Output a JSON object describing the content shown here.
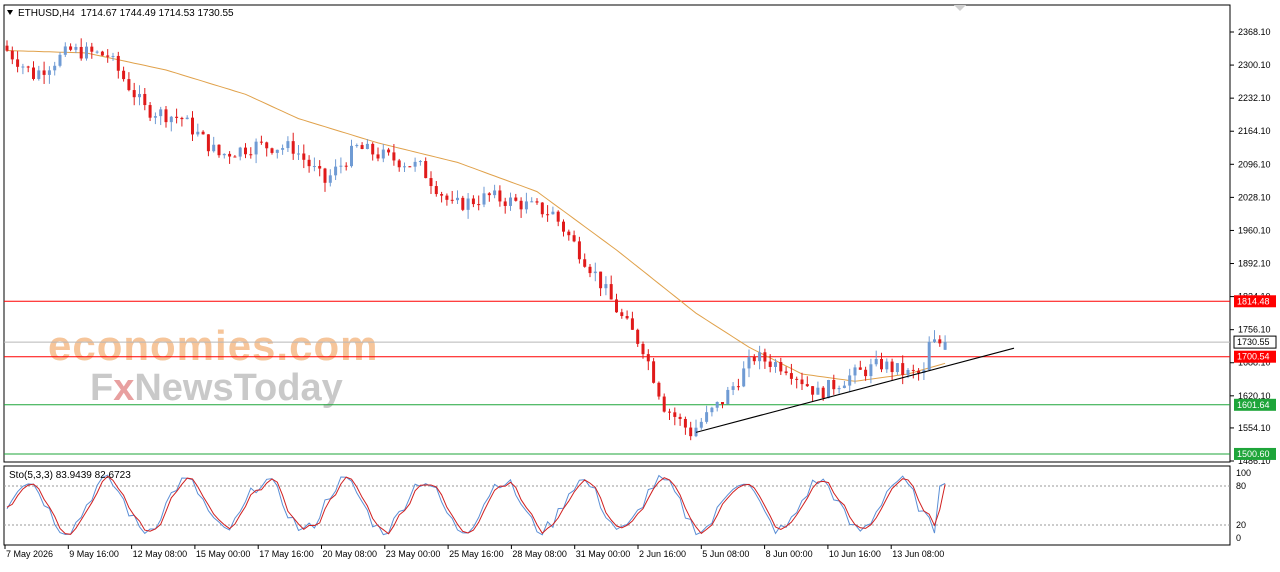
{
  "header": {
    "symbol": "ETHUSD,H4",
    "ohlc": "1714.67 1744.49 1714.53 1730.55",
    "stoch_label": "Sto(5,3,3) 83.9439 82.6723"
  },
  "watermark": {
    "line1": "economies.com",
    "line2_prefix": "F",
    "line2_x": "x",
    "line2_rest": "NewsToday"
  },
  "chart_data": {
    "type": "candlestick",
    "instrument": "ETHUSD",
    "timeframe": "H4",
    "y_ticks": [
      "2368.10",
      "2300.10",
      "2232.10",
      "2164.10",
      "2096.10",
      "2028.10",
      "1960.10",
      "1892.10",
      "1824.10",
      "1756.10",
      "1688.10",
      "1620.10",
      "1554.10",
      "1486.10"
    ],
    "x_ticks": [
      "7 May 2026",
      "9 May 16:00",
      "12 May 08:00",
      "15 May 00:00",
      "17 May 16:00",
      "20 May 08:00",
      "23 May 00:00",
      "25 May 16:00",
      "28 May 08:00",
      "31 May 00:00",
      "2 Jun 16:00",
      "5 Jun 08:00",
      "8 Jun 00:00",
      "10 Jun 16:00",
      "13 Jun 08:00"
    ],
    "ylim": [
      1480,
      2390
    ],
    "price_path": [
      [
        0,
        2340
      ],
      [
        6,
        2280
      ],
      [
        13,
        2330
      ],
      [
        20,
        2320
      ],
      [
        27,
        2210
      ],
      [
        34,
        2190
      ],
      [
        41,
        2115
      ],
      [
        48,
        2135
      ],
      [
        55,
        2130
      ],
      [
        61,
        2060
      ],
      [
        67,
        2130
      ],
      [
        73,
        2110
      ],
      [
        79,
        2090
      ],
      [
        85,
        2010
      ],
      [
        92,
        2030
      ],
      [
        98,
        2015
      ],
      [
        104,
        1995
      ],
      [
        112,
        1870
      ],
      [
        117,
        1780
      ],
      [
        121,
        1720
      ],
      [
        125,
        1600
      ],
      [
        130,
        1545
      ],
      [
        136,
        1610
      ],
      [
        142,
        1700
      ],
      [
        148,
        1680
      ],
      [
        154,
        1625
      ],
      [
        160,
        1660
      ],
      [
        166,
        1685
      ],
      [
        171,
        1665
      ],
      [
        174,
        1665
      ],
      [
        175,
        1725
      ],
      [
        178,
        1731
      ]
    ],
    "volatility": 16,
    "candle_count": 178,
    "ma_path": [
      [
        0,
        2330
      ],
      [
        15,
        2325
      ],
      [
        30,
        2290
      ],
      [
        45,
        2240
      ],
      [
        55,
        2190
      ],
      [
        70,
        2140
      ],
      [
        85,
        2100
      ],
      [
        100,
        2040
      ],
      [
        115,
        1920
      ],
      [
        130,
        1790
      ],
      [
        140,
        1720
      ],
      [
        150,
        1665
      ],
      [
        160,
        1650
      ],
      [
        170,
        1665
      ],
      [
        178,
        1690
      ]
    ],
    "levels": [
      {
        "value": 1814.48,
        "label": "1814.48",
        "color": "#ff0000",
        "style": "solid"
      },
      {
        "value": 1700.54,
        "label": "1700.54",
        "color": "#ff0000",
        "style": "solid"
      },
      {
        "value": 1601.64,
        "label": "1601.64",
        "color": "#1ea53a",
        "style": "solid"
      },
      {
        "value": 1500.6,
        "label": "1500.60",
        "color": "#1ea53a",
        "style": "solid"
      }
    ],
    "current_price": {
      "value": 1730.55,
      "label": "1730.55"
    },
    "trendline": {
      "from_index": 130,
      "from_value": 1545,
      "to_index": 190,
      "to_value": 1718
    },
    "bull_color": "#6f9bd4",
    "bear_color": "#e01a1a",
    "ma_color": "#e0a14a",
    "stochastic": {
      "main": "83.9439",
      "signal": "82.6723",
      "levels": [
        "100",
        "80",
        "20",
        "0"
      ],
      "main_color": "#5b8fd6",
      "signal_color": "#d12020"
    }
  }
}
